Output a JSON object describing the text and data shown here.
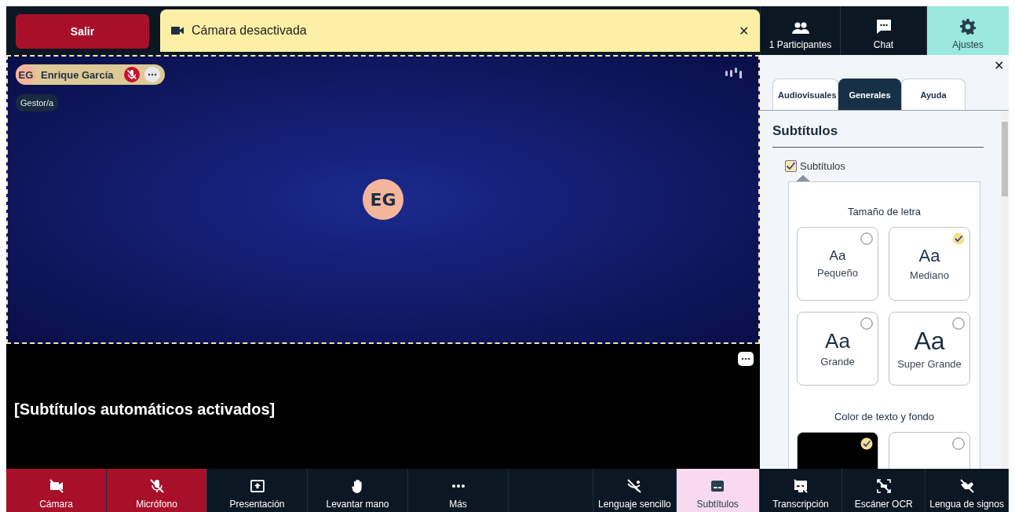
{
  "top_bar": {
    "exit_button": "Salir",
    "notification": {
      "text": "Cámara desactivada",
      "close": "✕"
    }
  },
  "side_tabs": [
    {
      "label": "1 Participantes",
      "selected": false
    },
    {
      "label": "Chat",
      "selected": false
    },
    {
      "label": "Ajustes",
      "selected": true
    }
  ],
  "video_tile": {
    "initials": "EG",
    "name_chip": {
      "initials": "EG",
      "name": "Enrique García",
      "muted": true
    },
    "role": "Gestor/a"
  },
  "captions": {
    "text": "[Subtítulos automáticos activados]"
  },
  "settings_panel": {
    "close": "✕",
    "tabs": [
      {
        "label": "Audiovisuales",
        "selected": false
      },
      {
        "label": "Generales",
        "selected": true
      },
      {
        "label": "Ayuda",
        "selected": false
      }
    ],
    "section_title": "Subtítulos",
    "subtitles_checkbox": {
      "label": "Subtítulos",
      "checked": true
    },
    "font_size": {
      "title": "Tamaño de letra",
      "options": [
        {
          "sample": "Aa",
          "label": "Pequeño",
          "selected": false
        },
        {
          "sample": "Aa",
          "label": "Mediano",
          "selected": true
        },
        {
          "sample": "Aa",
          "label": "Grande",
          "selected": false
        },
        {
          "sample": "Aa",
          "label": "Super Grande",
          "selected": false
        }
      ]
    },
    "text_color": {
      "title": "Color de texto y fondo",
      "options": [
        {
          "color": "#000000",
          "selected": true
        },
        {
          "color": "#ffffff",
          "selected": false
        }
      ]
    }
  },
  "toolbar": [
    {
      "label": "Cámara",
      "off": true,
      "warning": true,
      "selected": false
    },
    {
      "label": "Micrófono",
      "off": true,
      "warning": true,
      "selected": false
    },
    {
      "label": "Presentación",
      "off": false,
      "warning": false,
      "selected": false
    },
    {
      "label": "Levantar mano",
      "off": false,
      "warning": false,
      "selected": false
    },
    {
      "label": "Más",
      "off": false,
      "warning": false,
      "selected": false
    },
    {
      "label": "Lenguaje sencillo",
      "off": true,
      "warning": false,
      "selected": false
    },
    {
      "label": "Subtítulos",
      "off": false,
      "warning": false,
      "selected": true
    },
    {
      "label": "Transcripción",
      "off": true,
      "warning": false,
      "selected": false
    },
    {
      "label": "Escáner OCR",
      "off": true,
      "warning": false,
      "selected": false
    },
    {
      "label": "Lengua de signos",
      "off": true,
      "warning": false,
      "selected": false
    }
  ]
}
